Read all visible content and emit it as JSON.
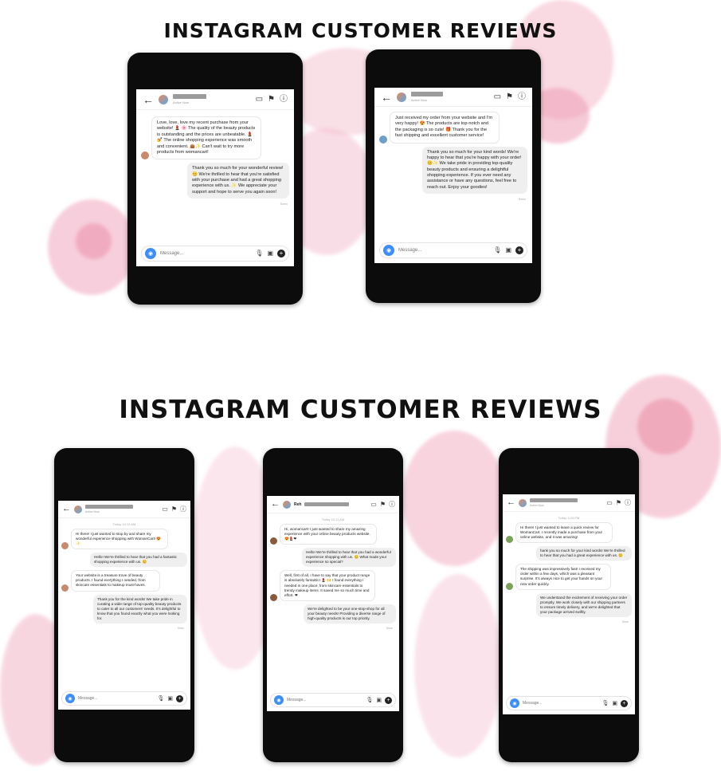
{
  "headings": {
    "top": "INSTAGRAM CUSTOMER REVIEWS",
    "bottom": "INSTAGRAM CUSTOMER REVIEWS"
  },
  "colors": {
    "pink_soft": "#f6c9d6",
    "pink_deep": "#eea3bb",
    "phone_body": "#0c0c0c",
    "bubble_out": "#efefef",
    "camera_blue": "#3e8ef7"
  },
  "icons": {
    "back": "back-arrow-icon",
    "video": "video-call-icon",
    "flag": "flag-icon",
    "info": "info-icon",
    "camera": "camera-icon",
    "mic": "microphone-icon",
    "gallery": "gallery-icon",
    "plus": "plus-icon"
  },
  "phones": [
    {
      "name": "",
      "status": "Active Now",
      "date": "",
      "seen": "Seen",
      "composer_placeholder": "Message...",
      "messages": [
        {
          "dir": "in",
          "text": "Love, love, love my recent purchase from your website! 💄 🌸 The quality of the beauty products is outstanding and the prices are unbeatable. 💄💅 The online shopping experience was smooth and convenient. 👜✨ Can't wait to try more products from womancart!"
        },
        {
          "dir": "out",
          "text": "Thank you so much for your wonderful review! 😊 We're thrilled to hear that you're satisfied with your purchase and had a great shopping experience with us. ✨ We appreciate your support and hope to serve you again soon!"
        }
      ]
    },
    {
      "name": "",
      "status": "Active Now",
      "date": "",
      "seen": "Seen",
      "composer_placeholder": "Message...",
      "messages": [
        {
          "dir": "in",
          "text": "Just received my order from your website and I'm very happy! 😍 The products are top-notch and the packaging is so cute! 🎁 Thank you for the fast shipping and excellent customer service!"
        },
        {
          "dir": "out",
          "text": "Thank you so much for your kind words! We're happy to hear that you're happy with your order! 😊✨ We take pride in providing top-quality beauty products and ensuring a delightful shopping experience. If you ever need any assistance or have any questions, feel free to reach out. Enjoy your goodies!"
        }
      ]
    },
    {
      "name": "",
      "status": "Active Now",
      "date": "Today 10:13 AM",
      "seen": "Seen",
      "composer_placeholder": "Message...",
      "messages": [
        {
          "dir": "in",
          "text": "Hi there! I just wanted to stop by and share my wonderful experience shopping with WomanCart! 😍✨"
        },
        {
          "dir": "out",
          "text": "Hello! We're thrilled to hear that you had a fantastic shopping experience with us. 😊"
        },
        {
          "dir": "in",
          "text": "Your website is a treasure trove of beauty products. I found everything I needed, from skincare essentials to makeup must-haves."
        },
        {
          "dir": "out",
          "text": "Thank you for the kind words! We take pride in curating a wide range of top-quality beauty products to cater to all our customers' needs. It's delightful to know that you found exactly what you were looking for."
        }
      ]
    },
    {
      "name": "Reh",
      "status": "",
      "date": "Today 10:11 AM",
      "seen": "Seen",
      "composer_placeholder": "Message...",
      "messages": [
        {
          "dir": "in",
          "text": "Hi, womancart! I just wanted to share my amazing experience with your online beauty products website. 😍💄❤"
        },
        {
          "dir": "out",
          "text": "Hello! We're thrilled to hear that you had a wonderful experience shopping with us. 😊 What made your experience so special?"
        },
        {
          "dir": "in",
          "text": "Well, first of all, I have to say that your product range is absolutely fantastic! 💄 🙌 I found everything I needed in one place, from skincare essentials to trendy makeup items. It saved me so much time and effort. ❤"
        },
        {
          "dir": "out",
          "text": "We're delighted to be your one-stop-shop for all your beauty needs! Providing a diverse range of high-quality products is our top priority."
        }
      ]
    },
    {
      "name": "",
      "status": "Active Now",
      "date": "Today 3:23 PM",
      "seen": "Seen",
      "composer_placeholder": "Message...",
      "messages": [
        {
          "dir": "in",
          "text": "Hi there! I just wanted to leave a quick review for WomanCart. I recently made a purchase from your online website, and it was amazing!"
        },
        {
          "dir": "out",
          "text": "hank you so much for your kind words! We're thrilled to hear that you had a great experience with us. 😊"
        },
        {
          "dir": "in",
          "text": "The shipping was impressively fast! I received my order within a few days, which was a pleasant surprise. It's always nice to get your hands on your new order quickly."
        },
        {
          "dir": "out",
          "text": "We understand the excitement of receiving your order promptly. We work closely with our shipping partners to ensure timely delivery, and we're delighted that your package arrived swiftly."
        }
      ]
    }
  ]
}
